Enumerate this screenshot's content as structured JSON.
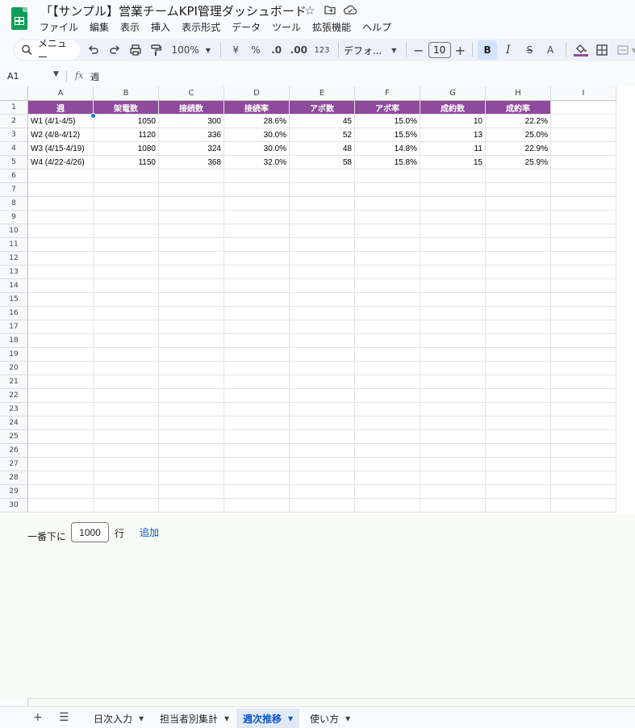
{
  "doc": {
    "title": "「【サンプル】営業チームKPI管理ダッシュボード"
  },
  "menu": [
    "ファイル",
    "編集",
    "表示",
    "挿入",
    "表示形式",
    "データ",
    "ツール",
    "拡張機能",
    "ヘルプ"
  ],
  "toolbar": {
    "search_label": "メニュー",
    "zoom": "100%",
    "currency": "¥",
    "percent": "%",
    "decrease_decimal": ".0",
    "increase_decimal": ".00",
    "number_format": "123",
    "font": "デフォ...",
    "font_size": "10",
    "bold": "B",
    "italic": "I",
    "strike": "S",
    "text_color": "A",
    "accent_color": "#8e4b9b"
  },
  "formula_bar": {
    "cell_ref": "A1",
    "fx": "fx",
    "value": "週"
  },
  "columns": [
    "A",
    "B",
    "C",
    "D",
    "E",
    "F",
    "G",
    "H",
    "I"
  ],
  "rows": [
    "1",
    "2",
    "3",
    "4",
    "5",
    "6",
    "7",
    "8",
    "9",
    "10",
    "11",
    "12",
    "13",
    "14",
    "15",
    "16",
    "17",
    "18",
    "19",
    "20",
    "21",
    "22",
    "23",
    "24",
    "25",
    "26",
    "27",
    "28",
    "29",
    "30"
  ],
  "table": {
    "header": [
      "週",
      "架電数",
      "接続数",
      "接続率",
      "アポ数",
      "アポ率",
      "成約数",
      "成約率"
    ],
    "data": [
      [
        "W1 (4/1-4/5)",
        "1050",
        "300",
        "28.6%",
        "45",
        "15.0%",
        "10",
        "22.2%"
      ],
      [
        "W2 (4/8-4/12)",
        "1120",
        "336",
        "30.0%",
        "52",
        "15.5%",
        "13",
        "25.0%"
      ],
      [
        "W3 (4/15-4/19)",
        "1080",
        "324",
        "30.0%",
        "48",
        "14.8%",
        "11",
        "22.9%"
      ],
      [
        "W4 (4/22-4/26)",
        "1150",
        "368",
        "32.0%",
        "58",
        "15.8%",
        "15",
        "25.9%"
      ]
    ],
    "header_color": "#8e4b9b"
  },
  "add_rows": {
    "prefix": "一番下に",
    "count": "1000",
    "unit": "行",
    "button": "追加"
  },
  "sheets": [
    {
      "label": "日次入力",
      "active": false
    },
    {
      "label": "担当者別集計",
      "active": false
    },
    {
      "label": "週次推移",
      "active": true
    },
    {
      "label": "使い方",
      "active": false
    }
  ],
  "icons": [
    "star-icon",
    "move-to-folder-icon",
    "cloud-saved-icon",
    "search-icon",
    "undo-icon",
    "redo-icon",
    "print-icon",
    "paint-format-icon",
    "borders-icon",
    "merge-icon",
    "add-sheet-icon",
    "all-sheets-icon"
  ]
}
